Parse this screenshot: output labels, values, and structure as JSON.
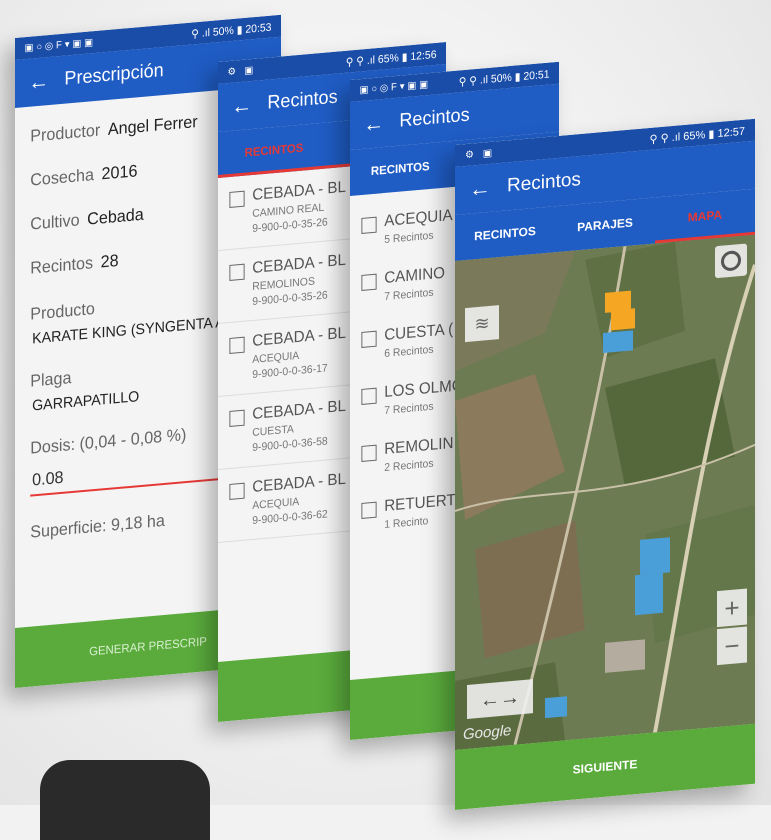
{
  "screen1": {
    "status": {
      "left": "▣○◎F▾▣▣",
      "right": "⚲ .ıl 50% ▮ 20:53"
    },
    "title": "Prescripción",
    "fields": [
      {
        "label": "Productor",
        "value": "Angel Ferrer"
      },
      {
        "label": "Cosecha",
        "value": "2016"
      },
      {
        "label": "Cultivo",
        "value": "Cebada"
      },
      {
        "label": "Recintos",
        "value": "28"
      }
    ],
    "producto_label": "Producto",
    "producto_value": "KARATE KING (SYNGENTA A",
    "plaga_label": "Plaga",
    "plaga_value": "GARRAPATILLO",
    "dosis_label": "Dosis: (0,04 - 0,08 %)",
    "dosis_value": "0.08",
    "superficie": "Superficie: 9,18 ha",
    "footer": "GENERAR PRESCRIP"
  },
  "screen2": {
    "status": {
      "left": "⚙ ▣",
      "right": "⚲ ⚲ .ıl 65% ▮ 12:56"
    },
    "title": "Recintos",
    "tab": "RECINTOS",
    "items": [
      {
        "main": "CEBADA - BL",
        "sub1": "CAMINO REAL",
        "sub2": "9-900-0-0-35-26"
      },
      {
        "main": "CEBADA - BL",
        "sub1": "REMOLINOS",
        "sub2": "9-900-0-0-35-26"
      },
      {
        "main": "CEBADA - BL",
        "sub1": "ACEQUIA",
        "sub2": "9-900-0-0-36-17"
      },
      {
        "main": "CEBADA - BL",
        "sub1": "CUESTA",
        "sub2": "9-900-0-0-36-58"
      },
      {
        "main": "CEBADA - BL",
        "sub1": "ACEQUIA",
        "sub2": "9-900-0-0-36-62"
      }
    ]
  },
  "screen3": {
    "status": {
      "left": "▣○◎F▾▣▣",
      "right": "⚲ ⚲ .ıl 50% ▮ 20:51"
    },
    "title": "Recintos",
    "tab": "RECINTOS",
    "items": [
      {
        "main": "ACEQUIA",
        "sub": "5 Recintos"
      },
      {
        "main": "CAMINO",
        "sub": "7 Recintos"
      },
      {
        "main": "CUESTA (",
        "sub": "6 Recintos"
      },
      {
        "main": "LOS OLMC",
        "sub": "7 Recintos"
      },
      {
        "main": "REMOLIN",
        "sub": "2 Recintos"
      },
      {
        "main": "RETUERT",
        "sub": "1 Recinto"
      }
    ]
  },
  "screen4": {
    "status": {
      "left": "⚙ ▣",
      "right": "⚲ ⚲ .ıl 65% ▮ 12:57"
    },
    "title": "Recintos",
    "tabs": [
      "RECINTOS",
      "PARAJES",
      "MAPA"
    ],
    "active_tab": "MAPA",
    "zoom_in": "+",
    "zoom_out": "−",
    "arrows": "←→",
    "map_brand": "Google",
    "footer": "SIGUIENTE",
    "colors": {
      "parcel_orange": "#f5a623",
      "parcel_blue": "#4a9fd8"
    }
  }
}
